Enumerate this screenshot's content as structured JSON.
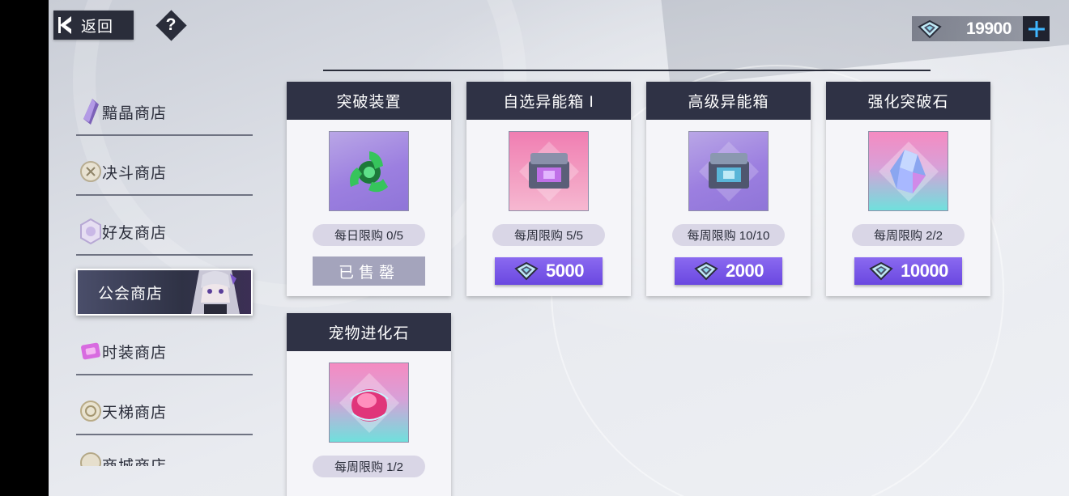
{
  "header": {
    "back_label": "返回",
    "help_label": "?",
    "currency_amount": "19900",
    "currency_icon": "gem-icon",
    "add_icon": "plus-icon"
  },
  "sidebar": {
    "items": [
      {
        "label": "黯晶商店",
        "icon": "crystal-shard-icon"
      },
      {
        "label": "决斗商店",
        "icon": "duel-coin-icon"
      },
      {
        "label": "好友商店",
        "icon": "friend-coin-icon"
      },
      {
        "label": "公会商店",
        "icon": "guild-portrait",
        "active": true
      },
      {
        "label": "时装商店",
        "icon": "fashion-ticket-icon"
      },
      {
        "label": "天梯商店",
        "icon": "ladder-coin-icon"
      },
      {
        "label": "商城商店",
        "icon": "partial-coin-icon"
      }
    ]
  },
  "products": [
    {
      "name": "突破装置",
      "limit": "每日限购 0/5",
      "status": "已售罄",
      "icon": "green-device-icon"
    },
    {
      "name": "自选异能箱 I",
      "limit": "每周限购 5/5",
      "price": "5000",
      "icon": "pink-chest-icon"
    },
    {
      "name": "高级异能箱",
      "limit": "每周限购 10/10",
      "price": "2000",
      "icon": "purple-chest-icon"
    },
    {
      "name": "强化突破石",
      "limit": "每周限购 2/2",
      "price": "10000",
      "icon": "crystal-stone-icon"
    },
    {
      "name": "宠物进化石",
      "limit": "每周限购 1/2",
      "icon": "pet-evolution-stone-icon"
    }
  ],
  "colors": {
    "dark_panel": "#2f3245",
    "price_button": "#7a5aea",
    "sold_out": "#a4a4bc",
    "limit_pill": "#d9d6e6"
  }
}
